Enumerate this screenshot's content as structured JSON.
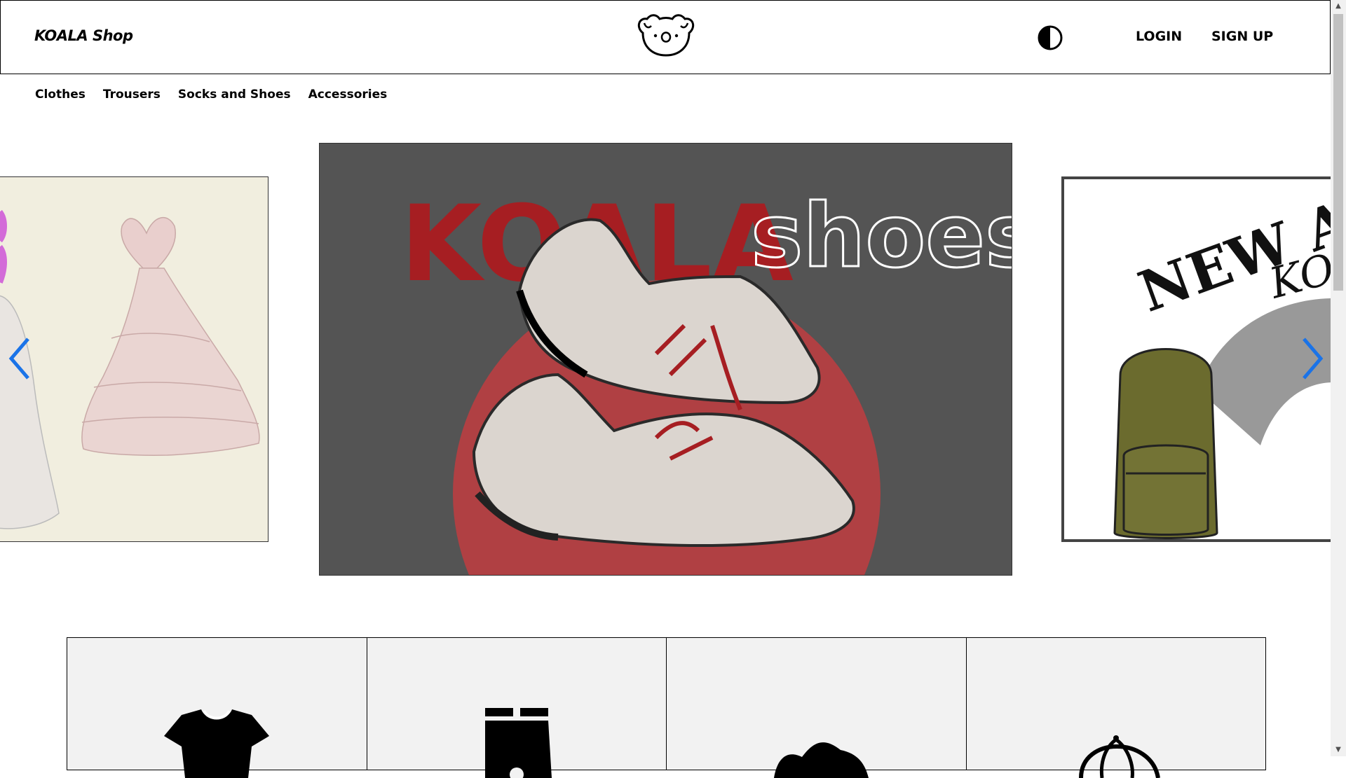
{
  "header": {
    "brand": "KOALA Shop",
    "login_label": "LOGIN",
    "signup_label": "SIGN UP",
    "theme_toggle_icon": "contrast-icon"
  },
  "categories_nav": [
    "Clothes",
    "Trousers",
    "Socks and Shoes",
    "Accessories"
  ],
  "carousel": {
    "center_slide": {
      "word1": "KOALA",
      "word2": "shoes",
      "background": "#545454",
      "word1_color": "#a61e22",
      "circle_color": "#b04043"
    },
    "right_slide": {
      "word1": "NEW A",
      "word2": "KO"
    },
    "arrow_color": "#1a73e8",
    "prev_icon": "chevron-left-icon",
    "next_icon": "chevron-right-icon"
  },
  "category_tiles": [
    {
      "icon": "tshirt-icon"
    },
    {
      "icon": "shorts-icon"
    },
    {
      "icon": "shoe-icon"
    },
    {
      "icon": "cap-icon"
    }
  ]
}
